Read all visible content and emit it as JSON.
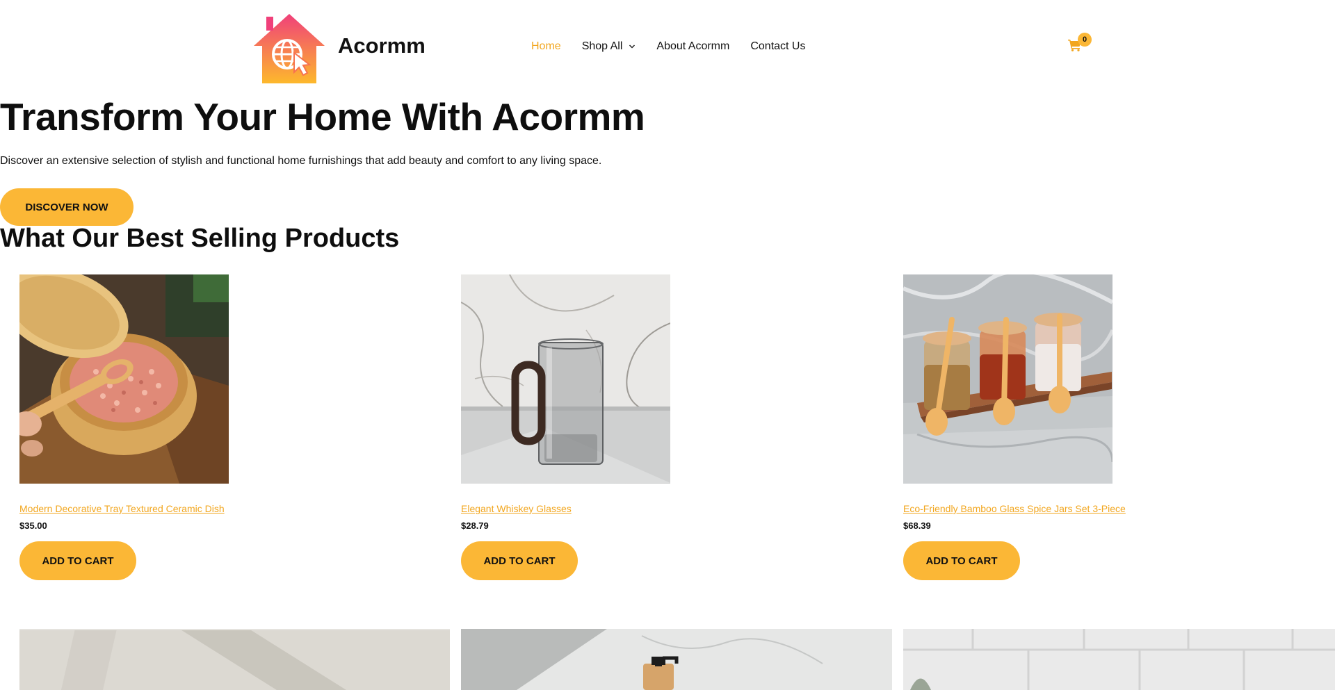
{
  "header": {
    "brand": "Acormm",
    "nav": [
      {
        "label": "Home",
        "active": true
      },
      {
        "label": "Shop All",
        "has_dropdown": true
      },
      {
        "label": "About Acormm"
      },
      {
        "label": "Contact Us"
      }
    ],
    "cart_icon": "cart-icon",
    "cart_count": "0"
  },
  "hero": {
    "title": "Transform Your Home With Acormm",
    "subtitle": "Discover an extensive selection of stylish and functional home furnishings that add beauty and comfort to any living space.",
    "cta": "DISCOVER NOW"
  },
  "products_section": {
    "title": "What Our Best Selling Products",
    "products": [
      {
        "name": "Modern Decorative Tray Textured Ceramic Dish",
        "price": "$35.00",
        "button": "ADD TO CART"
      },
      {
        "name": "Elegant Whiskey Glasses",
        "price": "$28.79",
        "button": "ADD TO CART"
      },
      {
        "name": "Eco-Friendly Bamboo Glass Spice Jars Set 3-Piece",
        "price": "$68.39",
        "button": "ADD TO CART"
      }
    ]
  },
  "colors": {
    "accent": "#FBB736",
    "link": "#F2A61E",
    "logo_top": "#F0407A",
    "logo_bottom": "#FDB92C"
  }
}
